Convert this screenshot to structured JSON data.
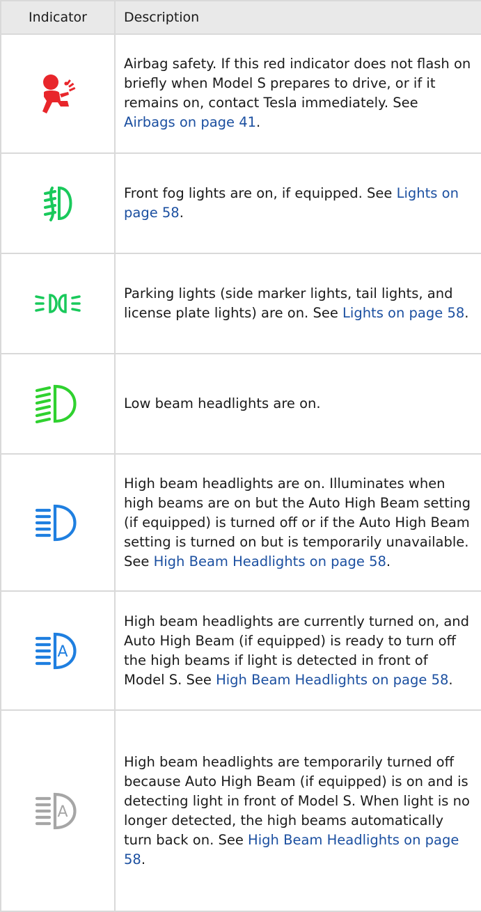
{
  "header": {
    "indicator": "Indicator",
    "description": "Description"
  },
  "rows": [
    {
      "icon": "airbag-icon",
      "color": "#e8262b",
      "text": "Airbag safety. If this red indicator does not flash on briefly when Model S prepares to drive, or if it remains on, contact Tesla immediately. See ",
      "link": "Airbags on page 41",
      "after": "."
    },
    {
      "icon": "front-fog-light-icon",
      "color": "#19c95b",
      "text": "Front fog lights are on, if equipped. See ",
      "link": "Lights on page 58",
      "after": "."
    },
    {
      "icon": "parking-lights-icon",
      "color": "#19c95b",
      "text": "Parking lights (side marker lights, tail lights, and license plate lights) are on. See ",
      "link": "Lights on page 58",
      "after": "."
    },
    {
      "icon": "low-beam-icon",
      "color": "#2fd12f",
      "text": "Low beam headlights are on.",
      "link": "",
      "after": ""
    },
    {
      "icon": "high-beam-icon",
      "color": "#1f7fe0",
      "text": "High beam headlights are on. Illuminates when high beams are on but the Auto High Beam setting (if equipped) is turned off or if the Auto High Beam setting is turned on but is temporarily unavailable. See ",
      "link": "High Beam Headlights on page 58",
      "after": "."
    },
    {
      "icon": "auto-high-beam-icon",
      "color": "#1f7fe0",
      "text": "High beam headlights are currently turned on, and Auto High Beam (if equipped) is ready to turn off the high beams if light is detected in front of Model S. See ",
      "link": "High Beam Headlights on page 58",
      "after": "."
    },
    {
      "icon": "auto-high-beam-off-icon",
      "color": "#a6a6a6",
      "text": "High beam headlights are temporarily turned off because Auto High Beam (if equipped) is on and is detecting light in front of Model S. When light is no longer detected, the high beams automatically turn back on. See ",
      "link": "High Beam Headlights on page 58",
      "after": "."
    }
  ]
}
